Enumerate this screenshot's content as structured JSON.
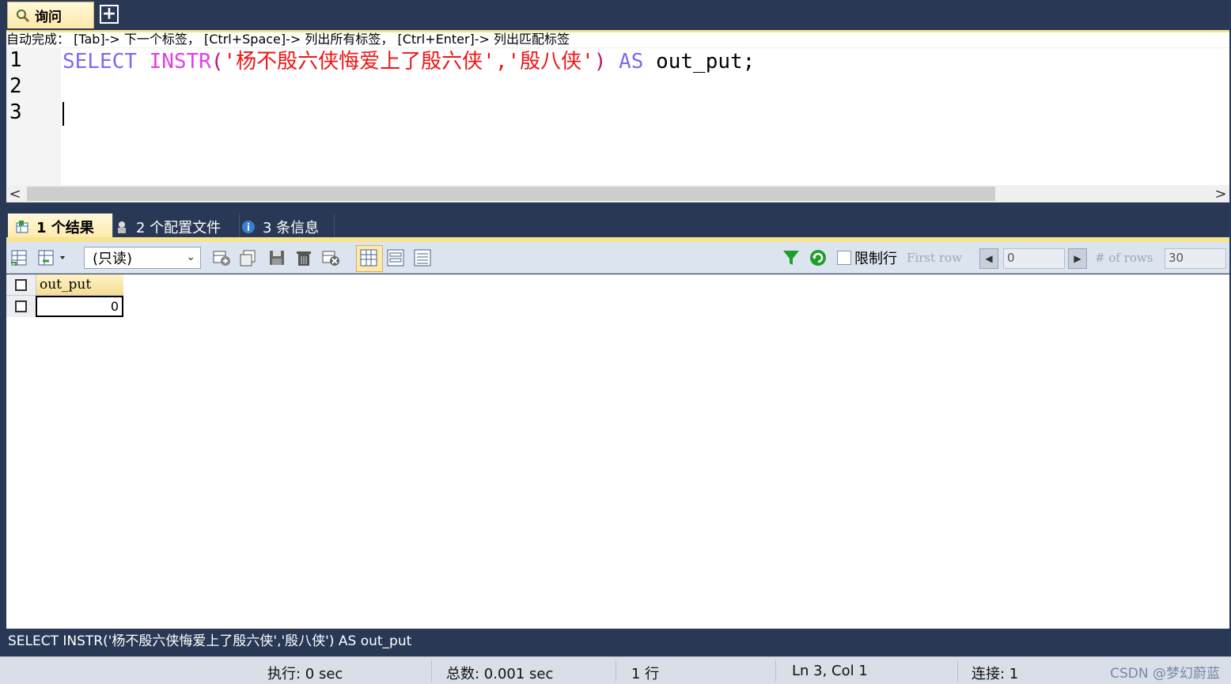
{
  "query_tab": {
    "label": "询问",
    "add_label": "+"
  },
  "hint": {
    "text": "自动完成： [Tab]-> 下一个标签， [Ctrl+Space]-> 列出所有标签， [Ctrl+Enter]-> 列出匹配标签"
  },
  "editor": {
    "line_numbers": [
      "1",
      "2",
      "3"
    ],
    "code": {
      "kw1": "SELECT",
      "fn": "INSTR",
      "lparen": "(",
      "str1": "'杨不殷六侠悔爱上了殷六侠'",
      "comma": ",",
      "str2": "'殷八侠'",
      "rparen": ")",
      "kw2": "AS",
      "alias": "out_put;"
    },
    "colors": {
      "keyword": "#7d6bf0",
      "function": "#e240e6",
      "string": "#ef1515"
    }
  },
  "scrollbar": {
    "left_arrow": "<",
    "right_arrow": ">"
  },
  "result_tabs": [
    {
      "label": "1 个结果",
      "icon": "result-grid-icon",
      "active": true
    },
    {
      "label": "2 个配置文件",
      "icon": "profile-icon",
      "active": false
    },
    {
      "label": "3 条信息",
      "icon": "info-icon",
      "active": false
    }
  ],
  "toolbar": {
    "mode": "(只读)",
    "limit_label": "限制行",
    "first_row_label": "First row",
    "first_row_value": "0",
    "rows_label": "# of rows",
    "rows_value": "30"
  },
  "grid": {
    "columns": [
      "out_put"
    ],
    "rows": [
      [
        "0"
      ]
    ]
  },
  "sql_echo": "SELECT INSTR('杨不殷六侠悔爱上了殷六侠','殷八侠') AS out_put",
  "status": {
    "exec": "执行: 0 sec",
    "total": "总数: 0.001 sec",
    "rows": "1 行",
    "cursor": "Ln 3, Col 1",
    "conn": "连接: 1",
    "watermark": "CSDN @梦幻蔚蓝"
  }
}
